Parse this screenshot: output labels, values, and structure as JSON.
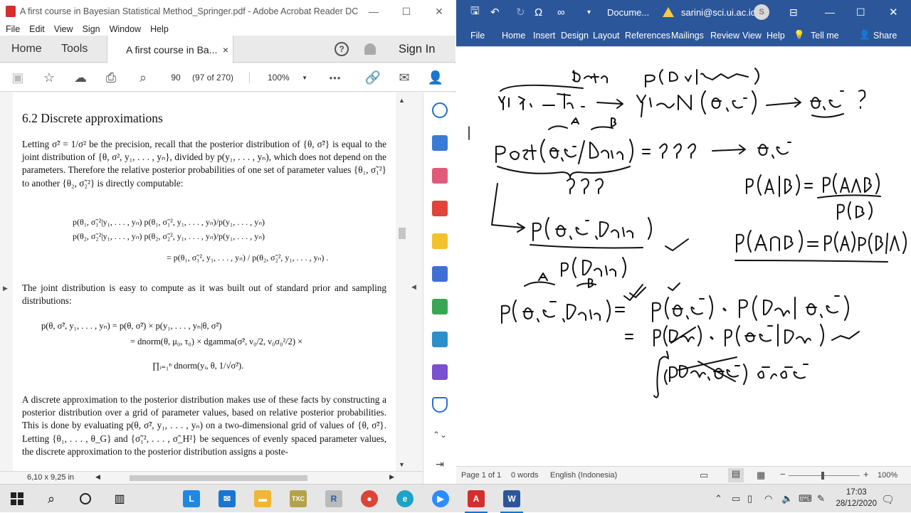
{
  "acrobat": {
    "title": "A first course in Bayesian Statistical Method_Springer.pdf - Adobe Acrobat Reader DC",
    "menu": [
      "File",
      "Edit",
      "View",
      "Sign",
      "Window",
      "Help"
    ],
    "tabs": {
      "home": "Home",
      "tools": "Tools",
      "document": "A first course in Ba...",
      "close": "×",
      "sign_in": "Sign In"
    },
    "toolbar": {
      "page_current": "90",
      "page_of": "(97 of 270)",
      "zoom": "100%",
      "more": "•••"
    },
    "status": {
      "dims": "6,10 x 9,25 in"
    },
    "pdf": {
      "heading": "6.2 Discrete approximations",
      "p1": "Letting σ̃² = 1/σ² be the precision, recall that the posterior distribution of {θ, σ̃²} is equal to the joint distribution of {θ, σ², y₁, . . . , yₙ}, divided by p(y₁, . . . , yₙ), which does not depend on the parameters. Therefore the relative posterior probabilities of one set of parameter values {θ₁, σ̃₁²} to another {θ₂, σ̃₂²} is directly computable:",
      "eq1a": "p(θ₁, σ̃₁²|y₁, . . . , yₙ)   p(θ₁, σ̃₁², y₁, . . . , yₙ)/p(y₁, . . . , yₙ)",
      "eq1b": "p(θ₂, σ̃₂²|y₁, . . . , yₙ)   p(θ₂, σ̃₂², y₁, . . . , yₙ)/p(y₁, . . . , yₙ)",
      "eq1c": "= p(θ₁, σ̃₁², y₁, . . . , yₙ) / p(θ₂, σ̃₂², y₁, . . . , yₙ) .",
      "p2": "The joint distribution is easy to compute as it was built out of standard prior and sampling distributions:",
      "eq2a": "p(θ, σ̃², y₁, . . . , yₙ) = p(θ, σ̃²) × p(y₁, . . . , yₙ|θ, σ̃²)",
      "eq2b": "= dnorm(θ, μ₀, τ₀) × dgamma(σ̃², ν₀/2, ν₀σ₀²/2) ×",
      "eq2c": "∏ᵢ₌₁ⁿ dnorm(yᵢ, θ, 1/√σ̃²).",
      "p3": "A discrete approximation to the posterior distribution makes use of these facts by constructing a posterior distribution over a grid of parameter values, based on relative posterior probabilities. This is done by evaluating p(θ, σ̃², y₁, . . . , yₙ) on a two-dimensional grid of values of {θ, σ̃²}. Letting {θ₁, . . . , θ_G} and {σ̃₁², . . . , σ̃_H²} be sequences of evenly spaced parameter values, the discrete approximation to the posterior distribution assigns a poste-"
    }
  },
  "word": {
    "doc_title": "Docume...",
    "user": "sarini@sci.ui.ac.id",
    "avatar": "S",
    "tabs": [
      "File",
      "Home",
      "Insert",
      "Design",
      "Layout",
      "References",
      "Mailings",
      "Review",
      "View",
      "Help",
      "Tell me",
      "Share"
    ],
    "status": {
      "page": "Page 1 of 1",
      "words": "0 words",
      "language": "English (Indonesia)",
      "zoom": "100%"
    },
    "colors": {
      "title_bar": "#2b579a"
    }
  },
  "taskbar": {
    "time": "17:03",
    "date": "28/12/2020"
  }
}
